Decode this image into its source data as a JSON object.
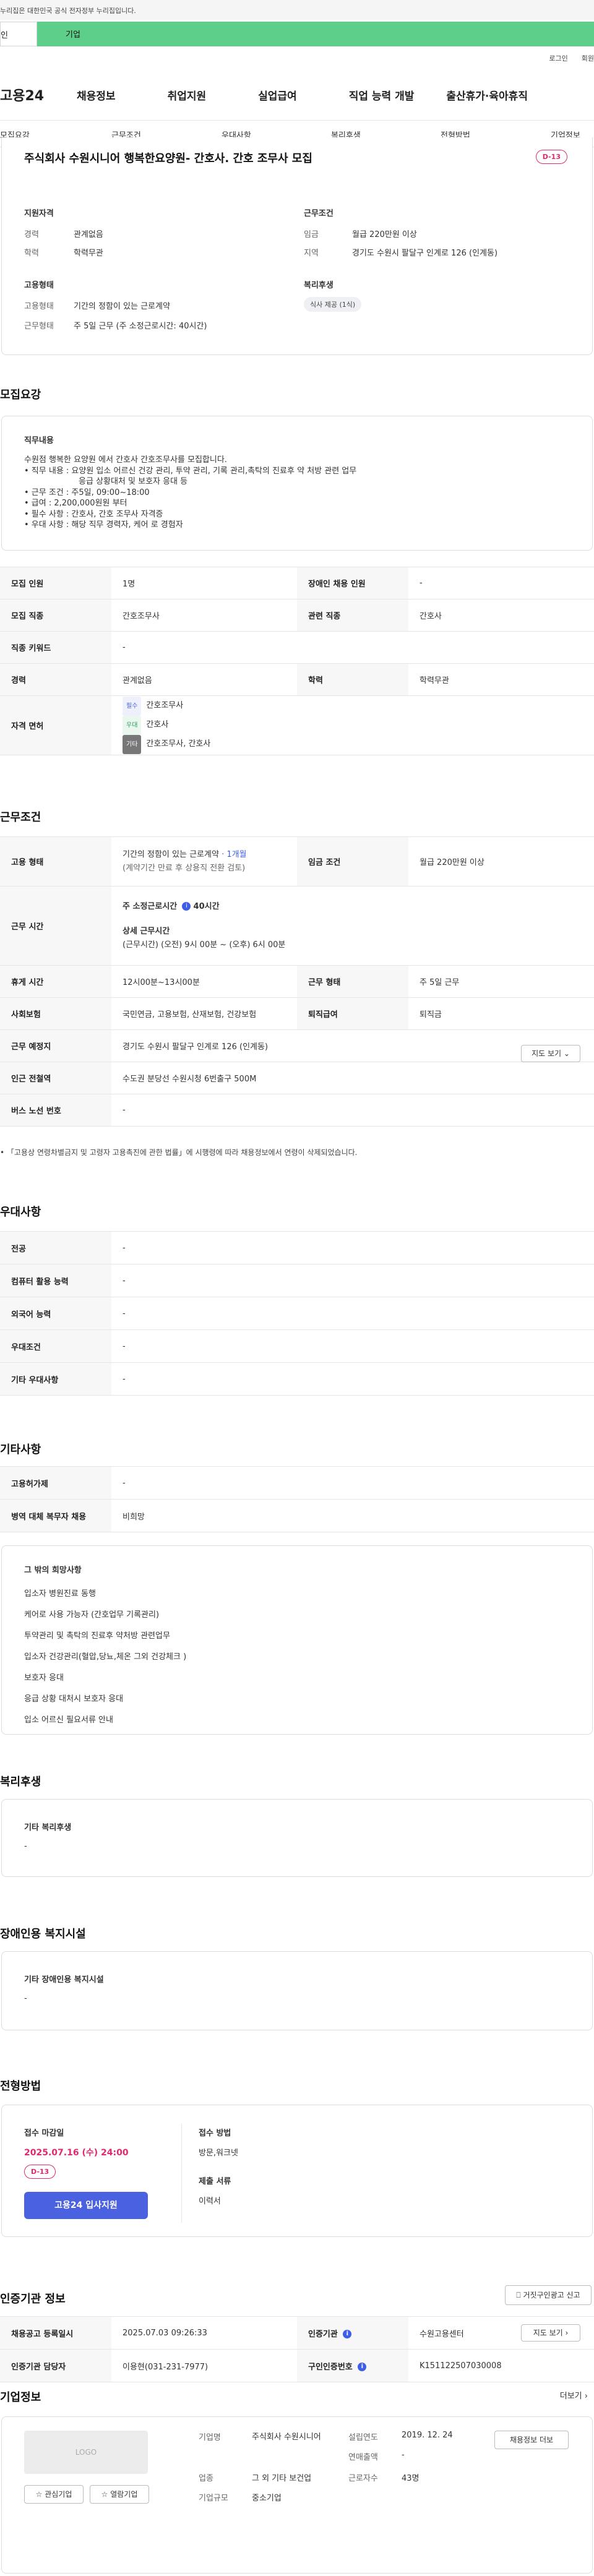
{
  "gov_bar": "누리집은 대한민국 공식 전자정부 누리집입니다.",
  "tabs": [
    "인",
    "기업"
  ],
  "util": [
    "로그인",
    "회원"
  ],
  "gnb": {
    "logo": "고용24",
    "menu": [
      "채용정보",
      "취업지원",
      "실업급여",
      "직업 능력 개발",
      "출산휴가·육아휴직"
    ]
  },
  "lnb": [
    "모집요강",
    "근무조건",
    "우대사항",
    "복리후생",
    "전형방법",
    "기업정보"
  ],
  "job": {
    "title": "주식회사 수원시니어 행복한요양원- 간호사. 간호 조무사 모집",
    "dday": "D-13",
    "left": {
      "h1": "지원자격",
      "r1l": "경력",
      "r1v": "관계없음",
      "r2l": "학력",
      "r2v": "학력무관",
      "h2": "고용형태",
      "r3l": "고용형태",
      "r3v": "기간의 정함이 있는 근로계약",
      "r4l": "근무형태",
      "r4v": "주 5일 근무 (주 소정근로시간: 40시간)"
    },
    "right": {
      "h1": "근무조건",
      "r1l": "임금",
      "r1v": "월급 220만원 이상",
      "r2l": "지역",
      "r2v": "경기도 수원시 팔달구 인계로 126 (인계동)",
      "h2": "복리후생",
      "tag": "식사 제공 (1식)"
    }
  },
  "sec_recruit": "모집요강",
  "duty": {
    "h": "직무내용",
    "lines": [
      "수원점 행복한 요양원 에서 간호사 간호조무사를 모집합니다.",
      "• 직무 내용 : 요양원 입소 어르신 건강 관리, 투약 관리, 기록 관리,촉탁의 진료후 약 처방 관련 업무",
      "응급 상황대처 및 보호자 응대 등",
      "• 근무 조건 : 주5일, 09:00~18:00",
      "• 급여 : 2,200,000원원 부터",
      "• 필수 사항 : 간호사, 간호 조무사 자격증",
      "• 우대 사항 : 해당 직무 경력자, 케어 로 경험자"
    ]
  },
  "recruit_rows": [
    {
      "l1": "모집 인원",
      "v1": "1명",
      "l2": "장애인 채용 인원",
      "v2": "-"
    },
    {
      "l1": "모집 직종",
      "v1": "간호조무사",
      "l2": "관련 직종",
      "v2": "간호사"
    },
    {
      "l1": "직종 키워드",
      "v1": "-"
    },
    {
      "l1": "경력",
      "v1": "관계없음",
      "l2": "학력",
      "v2": "학력무관"
    }
  ],
  "license": {
    "l": "자격 면허",
    "items": [
      {
        "tag": "필수",
        "name": "간호조무사"
      },
      {
        "tag": "우대",
        "name": "간호사"
      },
      {
        "tag": "기타",
        "name": "간호조무사, 간호사"
      }
    ]
  },
  "sec_work": "근무조건",
  "work": {
    "emp_l": "고용 형태",
    "emp_v": "기간의 정함이 있는 근로계약",
    "emp_link": "· 1개월",
    "emp_sub": "(계약기간 만료 후 상용직 전환 검토)",
    "pay_l": "임금 조건",
    "pay_v": "월급 220만원 이상",
    "time_l": "근무 시간",
    "time_h1": "주 소정근로시간",
    "time_h1v": "40시간",
    "time_h2": "상세 근무시간",
    "time_v2": "(근무시간) (오전) 9시 00분 ~ (오후) 6시 00분",
    "rest_l": "휴게 시간",
    "rest_v": "12시00분~13시00분",
    "form_l": "근무 형태",
    "form_v": "주 5일 근무",
    "ins_l": "사회보험",
    "ins_v": "국민연금, 고용보험, 산재보험, 건강보험",
    "ret_l": "퇴직급여",
    "ret_v": "퇴직금",
    "place_l": "근무 예정지",
    "place_v": "경기도 수원시 팔달구 인계로 126 (인계동)",
    "map_btn": "지도 보기",
    "sub_l": "인근 전철역",
    "sub_v": "수도권 분당선 수원시청 6번출구 500M",
    "bus_l": "버스 노선 번호",
    "bus_v": "-"
  },
  "work_note": "• 「고용상 연령차별금지 및 고령자 고용촉진에 관한 법률」에 시행령에 따라 채용정보에서 연령이 삭제되었습니다.",
  "sec_pref": "우대사항",
  "pref_rows": [
    {
      "l": "전공",
      "v": "-"
    },
    {
      "l": "컴퓨터 활용 능력",
      "v": "-"
    },
    {
      "l": "외국어 능력",
      "v": "-"
    },
    {
      "l": "우대조건",
      "v": "-"
    },
    {
      "l": "기타 우대사항",
      "v": "-"
    }
  ],
  "sec_etc": "기타사항",
  "etc_rows": [
    {
      "l": "고용허가제",
      "v": "-"
    },
    {
      "l": "병역 대체 복무자 채용",
      "v": "비희망"
    }
  ],
  "etc_box": {
    "h": "그 밖의 희망사항",
    "items": [
      "입소자 병원진료 동행",
      "케어로 사용 가능자 (간호업무 기록관리)",
      "투약관리 및 촉탁의 진료후 약처방 관련업무",
      "입소자 건강관리(혈압,당뇨,체온 그외 건강체크 )",
      "보호자 응대",
      "응급 상황 대처시 보호자 응대",
      "입소 어르신 필요서류 안내"
    ]
  },
  "sec_welfare": "복리후생",
  "welfare": {
    "h": "기타 복리후생",
    "v": "-"
  },
  "sec_disab": "장애인용 복지시설",
  "disab": {
    "h": "기타 장애인용 복지시설",
    "v": "-"
  },
  "sec_proc": "전형방법",
  "proc": {
    "deadline_h": "접수 마감일",
    "deadline": "2025.07.16 (수) 24:00",
    "dday": "D-13",
    "apply": "고용24 입사지원",
    "method_h": "접수 방법",
    "method_v": "방문,워크넷",
    "docs_h": "제출 서류",
    "docs_v": "이력서"
  },
  "sec_cert": "인증기관 정보",
  "cert_report": "거짓구인광고 신고",
  "cert": {
    "r1l1": "채용공고 등록일시",
    "r1v1": "2025.07.03 09:26:33",
    "r1l2": "인증기관",
    "r1v2": "수원고용센터",
    "map_btn": "지도 보기",
    "r2l1": "인증기관 담당자",
    "r2v1": "이용현(031-231-7977)",
    "r2l2": "구인인증번호",
    "r2v2": "K151122507030008"
  },
  "sec_company": "기업정보",
  "more": "더보기",
  "company": {
    "logo": "LOGO",
    "fav": "관심기업",
    "visit": "열람기업",
    "n_l": "기업명",
    "n_v": "주식회사 수원시니어",
    "ind_l": "업종",
    "ind_v": "그 외 기타 보건업",
    "size_l": "기업규모",
    "size_v": "중소기업",
    "est_l": "설립연도",
    "est_v": "2019. 12. 24",
    "sales_l": "연매출액",
    "sales_v": "-",
    "emp_l": "근로자수",
    "emp_v": "43명",
    "info_btn": "채용정보 더보"
  }
}
